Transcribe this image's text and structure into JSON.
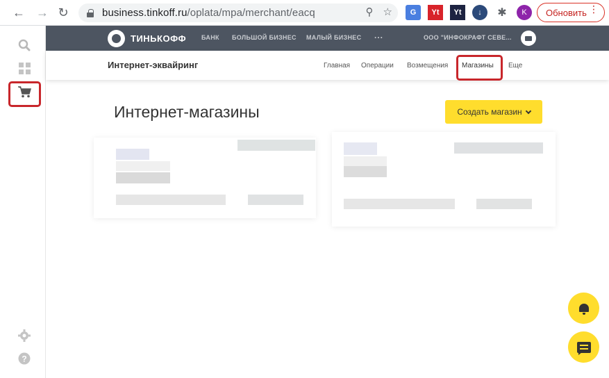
{
  "browser": {
    "url_host": "business.tinkoff.ru",
    "url_path": "/oplata/mpa/merchant/eacq",
    "update_label": "Обновить",
    "profile_initial": "K",
    "ext_yt1": "Yt",
    "ext_yt2": "Yt"
  },
  "topbar": {
    "logo": "ТИНЬКОФФ",
    "links": [
      "БАНК",
      "БОЛЬШОЙ БИЗНЕС",
      "МАЛЫЙ БИЗНЕС",
      "···"
    ],
    "company": "ООО \"ИНФОКРАФТ СЕВЕ..."
  },
  "subnav": {
    "title": "Интернет-эквайринг",
    "links": [
      "Главная",
      "Операции",
      "Возмещения",
      "Магазины",
      "Еще"
    ]
  },
  "main": {
    "title": "Интернет-магазины",
    "create_button": "Создать магазин"
  },
  "colors": {
    "accent_yellow": "#ffdd2d",
    "topbar": "#4d5561",
    "highlight_red": "#c8262b"
  }
}
